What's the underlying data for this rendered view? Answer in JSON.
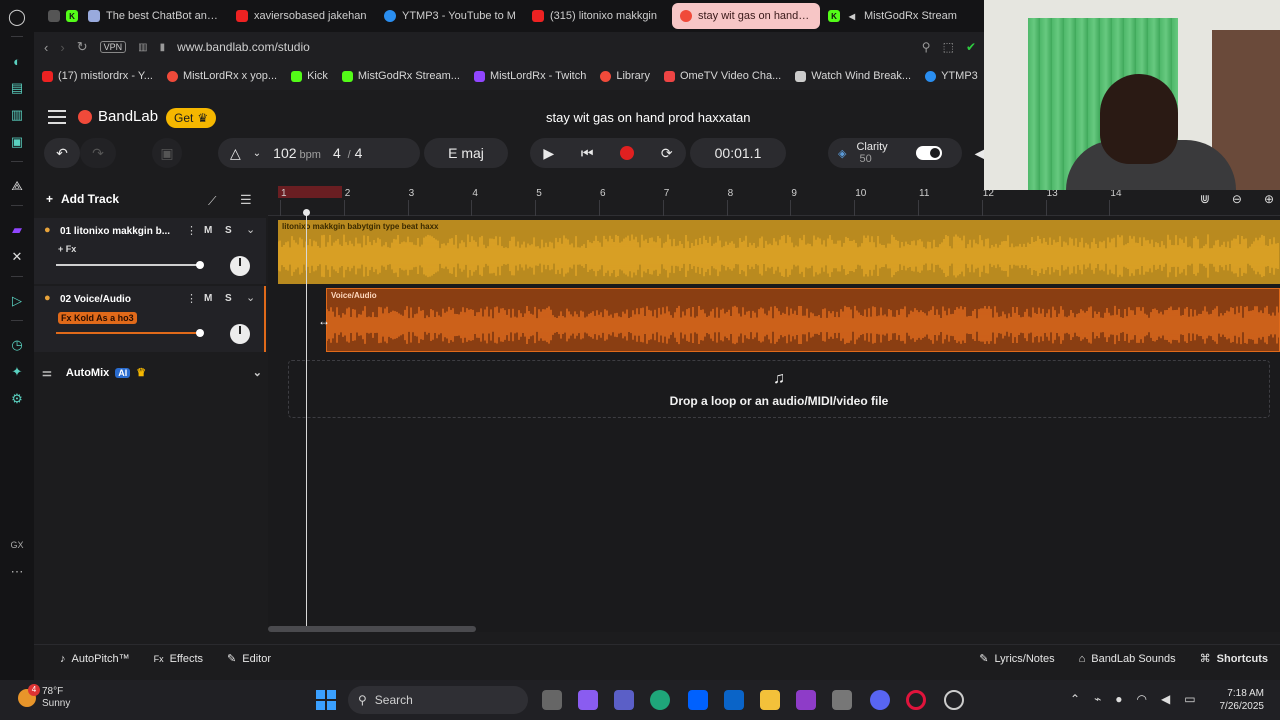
{
  "browser": {
    "tabs": [
      {
        "title": "The best ChatBot and V",
        "icon": "chatbot-icon",
        "color": "#9ad"
      },
      {
        "title": "xaviersobased jakehan",
        "icon": "youtube-icon",
        "color": "#e22"
      },
      {
        "title": "YTMP3 - YouTube to M",
        "icon": "ytmp3-icon",
        "color": "#2a8ef0"
      },
      {
        "title": "(315) litonixo makkgin",
        "icon": "youtube-icon",
        "color": "#e22"
      },
      {
        "title": "stay wit gas on hand pro",
        "icon": "bandlab-icon",
        "color": "#f04a3a"
      },
      {
        "title": "MistGodRx Stream",
        "icon": "kick-icon",
        "color": "#53fc18"
      }
    ],
    "vpn": "VPN",
    "url": "www.bandlab.com/studio",
    "bookmarks": [
      {
        "label": "(17) mistlordrx - Y...",
        "color": "#e22"
      },
      {
        "label": "MistLordRx x yop...",
        "color": "#f04a3a"
      },
      {
        "label": "Kick",
        "color": "#53fc18"
      },
      {
        "label": "MistGodRx Stream...",
        "color": "#53fc18"
      },
      {
        "label": "MistLordRx - Twitch",
        "color": "#9146ff"
      },
      {
        "label": "Library",
        "color": "#f04a3a"
      },
      {
        "label": "OmeTV Video Cha...",
        "color": "#e44"
      },
      {
        "label": "Watch Wind Break...",
        "color": "#ccc"
      },
      {
        "label": "YTMP3",
        "color": "#2a8ef0"
      }
    ]
  },
  "app": {
    "brand": "BandLab",
    "get_label": "Get",
    "project_title": "stay wit gas on hand prod haxxatan",
    "bpm": "102",
    "bpm_unit": "bpm",
    "time_sig_num": "4",
    "time_sig_sep": "/",
    "time_sig_den": "4",
    "key": "E maj",
    "position": "00:01.1",
    "clarity_label": "Clarity",
    "clarity_value": "50",
    "add_track": "Add Track",
    "automix": "AutoMix",
    "ai_badge": "AI",
    "mute": "M",
    "solo": "S",
    "tracks": [
      {
        "name": "01  litonixo makkgin b...",
        "fx": "+ Fx",
        "clip": "litonixo makkgin babytgin type beat haxx"
      },
      {
        "name": "02  Voice/Audio",
        "fx": "Fx Kold As a ho3",
        "clip": "Voice/Audio"
      }
    ],
    "ruler": [
      "1",
      "2",
      "3",
      "4",
      "5",
      "6",
      "7",
      "8",
      "9",
      "10",
      "11",
      "12",
      "13",
      "14"
    ],
    "dropzone_text": "Drop a loop or an audio/MIDI/video file",
    "bottom": {
      "autopitch": "AutoPitch™",
      "effects": "Effects",
      "editor": "Editor",
      "lyrics": "Lyrics/Notes",
      "sounds": "BandLab Sounds",
      "shortcuts": "Shortcuts"
    },
    "colors": {
      "track1": "#e6a826",
      "track2": "#e8701e",
      "accent": "#f04a3a"
    }
  },
  "taskbar": {
    "temp": "78°F",
    "weather": "Sunny",
    "search": "Search",
    "time": "7:18 AM",
    "date": "7/26/2025",
    "badge": "4"
  }
}
